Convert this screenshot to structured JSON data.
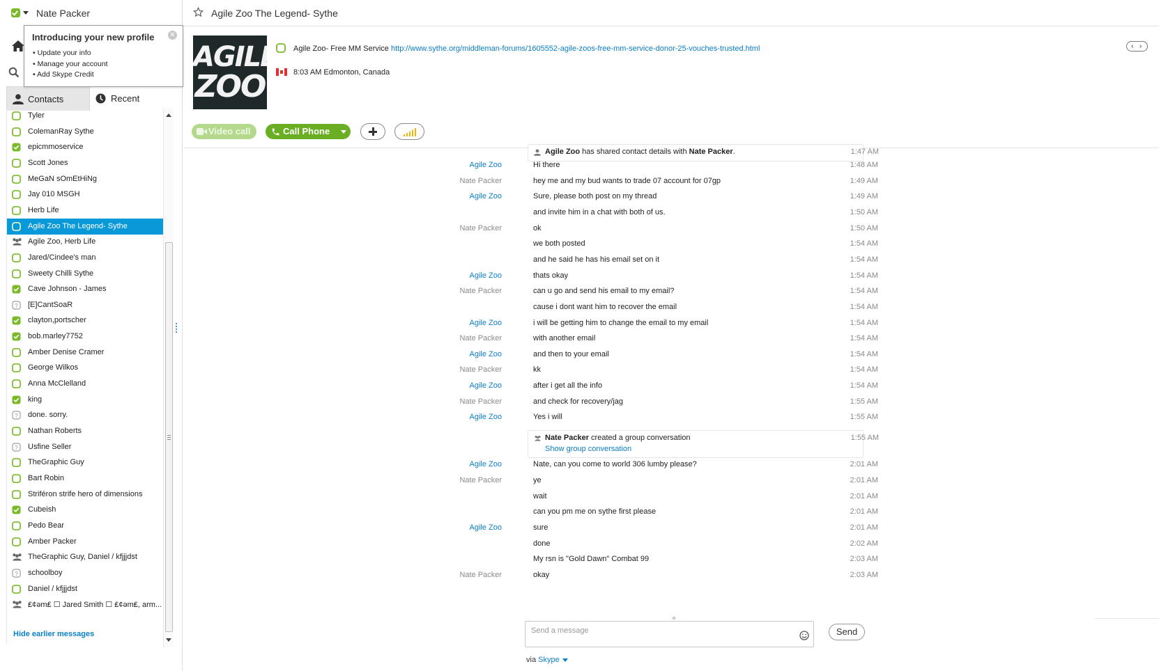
{
  "profile": {
    "name": "Nate Packer",
    "status_color": "#7bb928"
  },
  "popup": {
    "title": "Introducing your new profile",
    "items": [
      "Update your info",
      "Manage your account",
      "Add Skype Credit"
    ]
  },
  "tabs": {
    "contacts": "Contacts",
    "recent": "Recent"
  },
  "contacts": [
    {
      "name": "Tyler",
      "icon": "status-offline-icon"
    },
    {
      "name": "ColemanRay Sythe",
      "icon": "status-offline-icon"
    },
    {
      "name": "epicmmoservice",
      "icon": "status-online-icon"
    },
    {
      "name": "Scott Jones",
      "icon": "status-offline-icon"
    },
    {
      "name": "MeGaN sOmEtHiNg",
      "icon": "status-offline-icon"
    },
    {
      "name": "Jay 010 MSGH",
      "icon": "status-offline-icon"
    },
    {
      "name": "Herb Life",
      "icon": "status-offline-icon"
    },
    {
      "name": "Agile Zoo The Legend- Sythe",
      "icon": "status-offline-icon",
      "selected": true
    },
    {
      "name": "Agile Zoo, Herb Life",
      "icon": "group-icon"
    },
    {
      "name": "Jared/Cindee's man",
      "icon": "status-offline-icon"
    },
    {
      "name": "Sweety Chilli Sythe",
      "icon": "status-offline-icon"
    },
    {
      "name": "Cave Johnson - James",
      "icon": "status-online-icon"
    },
    {
      "name": "[E]CantSoaR",
      "icon": "status-unknown-icon"
    },
    {
      "name": "clayton,portscher",
      "icon": "status-online-icon"
    },
    {
      "name": "bob.marley7752",
      "icon": "status-online-icon"
    },
    {
      "name": "Amber Denise Cramer",
      "icon": "status-offline-icon"
    },
    {
      "name": "George Wilkos",
      "icon": "status-offline-icon"
    },
    {
      "name": "Anna McClelland",
      "icon": "status-offline-icon"
    },
    {
      "name": "king",
      "icon": "status-online-icon"
    },
    {
      "name": "done. sorry.",
      "icon": "status-unknown-icon"
    },
    {
      "name": "Nathan Roberts",
      "icon": "status-offline-icon"
    },
    {
      "name": "Usfine Seller",
      "icon": "status-unknown-icon"
    },
    {
      "name": "TheGraphic Guy",
      "icon": "status-offline-icon"
    },
    {
      "name": "Bart Robin",
      "icon": "status-offline-icon"
    },
    {
      "name": "Striféron strife hero of dimensions",
      "icon": "status-offline-icon"
    },
    {
      "name": "Cubeish",
      "icon": "status-online-icon"
    },
    {
      "name": "Pedo Bear",
      "icon": "status-offline-icon"
    },
    {
      "name": "Amber Packer",
      "icon": "status-offline-icon"
    },
    {
      "name": "TheGraphic Guy, Daniel / kfjjjdst",
      "icon": "group-icon"
    },
    {
      "name": "schoolboy",
      "icon": "status-unknown-icon"
    },
    {
      "name": "Daniel / kfjjjdst",
      "icon": "status-offline-icon"
    },
    {
      "name": "₤¢ǝm₤ ☐ Jared Smith ☐ ₤¢ǝm₤, arm...",
      "icon": "group-icon"
    }
  ],
  "sidebar_footer": {
    "hide_earlier": "Hide earlier messages"
  },
  "conversation": {
    "title": "Agile Zoo The Legend- Sythe",
    "avatar_text": [
      "AGILE",
      "ZOO"
    ],
    "mood_prefix": "Agile Zoo- Free MM Service ",
    "mood_link": "http://www.sythe.org/middleman-forums/1605552-agile-zoos-free-mm-service-donor-25-vouches-trusted.html",
    "location": "8:03 AM Edmonton, Canada",
    "buttons": {
      "video": "Video call",
      "call": "Call Phone"
    }
  },
  "colors": {
    "accent": "#0a99d8",
    "green": "#6aaf23",
    "link": "#0a7ec8"
  },
  "system_events": [
    {
      "actor": "Agile Zoo",
      "pre": " has shared contact details with ",
      "target": "Nate Packer",
      "post": ".",
      "time": "1:47 AM"
    },
    {
      "actor": "Nate Packer",
      "pre": " created a group conversation",
      "link": "Show group conversation",
      "time": "1:55 AM"
    }
  ],
  "messages": [
    {
      "sender": "Agile Zoo",
      "text": "Hi there",
      "time": "1:48 AM"
    },
    {
      "sender": "Nate Packer",
      "text": "hey me and my bud wants to trade 07 account for 07gp",
      "time": "1:49 AM"
    },
    {
      "sender": "Agile Zoo",
      "text": "Sure, please both post on my thread",
      "time": "1:49 AM"
    },
    {
      "sender": "",
      "text": "and invite him in a chat with both of us.",
      "time": "1:50 AM"
    },
    {
      "sender": "Nate Packer",
      "text": "ok",
      "time": "1:50 AM"
    },
    {
      "sender": "",
      "text": "we both posted",
      "time": "1:54 AM"
    },
    {
      "sender": "",
      "text": "and he said he has his email set on it",
      "time": "1:54 AM"
    },
    {
      "sender": "Agile Zoo",
      "text": "thats okay",
      "time": "1:54 AM"
    },
    {
      "sender": "Nate Packer",
      "text": "can u go and send his email to my email?",
      "time": "1:54 AM"
    },
    {
      "sender": "",
      "text": "cause i dont want him to recover the email",
      "time": "1:54 AM"
    },
    {
      "sender": "Agile Zoo",
      "text": "i will be getting him to change the email to my email",
      "time": "1:54 AM"
    },
    {
      "sender": "Nate Packer",
      "text": "with another email",
      "time": "1:54 AM"
    },
    {
      "sender": "Agile Zoo",
      "text": "and then to your email",
      "time": "1:54 AM"
    },
    {
      "sender": "Nate Packer",
      "text": "kk",
      "time": "1:54 AM"
    },
    {
      "sender": "Agile Zoo",
      "text": "after i get all the info",
      "time": "1:54 AM"
    },
    {
      "sender": "Nate Packer",
      "text": "and check for recovery/jag",
      "time": "1:55 AM"
    },
    {
      "sender": "Agile Zoo",
      "text": "Yes i will",
      "time": "1:55 AM"
    },
    {
      "sender": "Agile Zoo",
      "text": "Nate, can you come to world 306 lumby please?",
      "time": "2:01 AM"
    },
    {
      "sender": "Nate Packer",
      "text": "ye",
      "time": "2:01 AM"
    },
    {
      "sender": "",
      "text": "wait",
      "time": "2:01 AM"
    },
    {
      "sender": "",
      "text": "can you pm me on sythe first please",
      "time": "2:01 AM"
    },
    {
      "sender": "Agile Zoo",
      "text": "sure",
      "time": "2:01 AM"
    },
    {
      "sender": "",
      "text": "done",
      "time": "2:02 AM"
    },
    {
      "sender": "",
      "text": "My rsn is \"Gold Dawn\" Combat 99",
      "time": "2:03 AM"
    },
    {
      "sender": "Nate Packer",
      "text": "okay",
      "time": "2:03 AM"
    }
  ],
  "compose": {
    "placeholder": "Send a message",
    "send_label": "Send",
    "via_prefix": "via ",
    "via_service": "Skype"
  }
}
